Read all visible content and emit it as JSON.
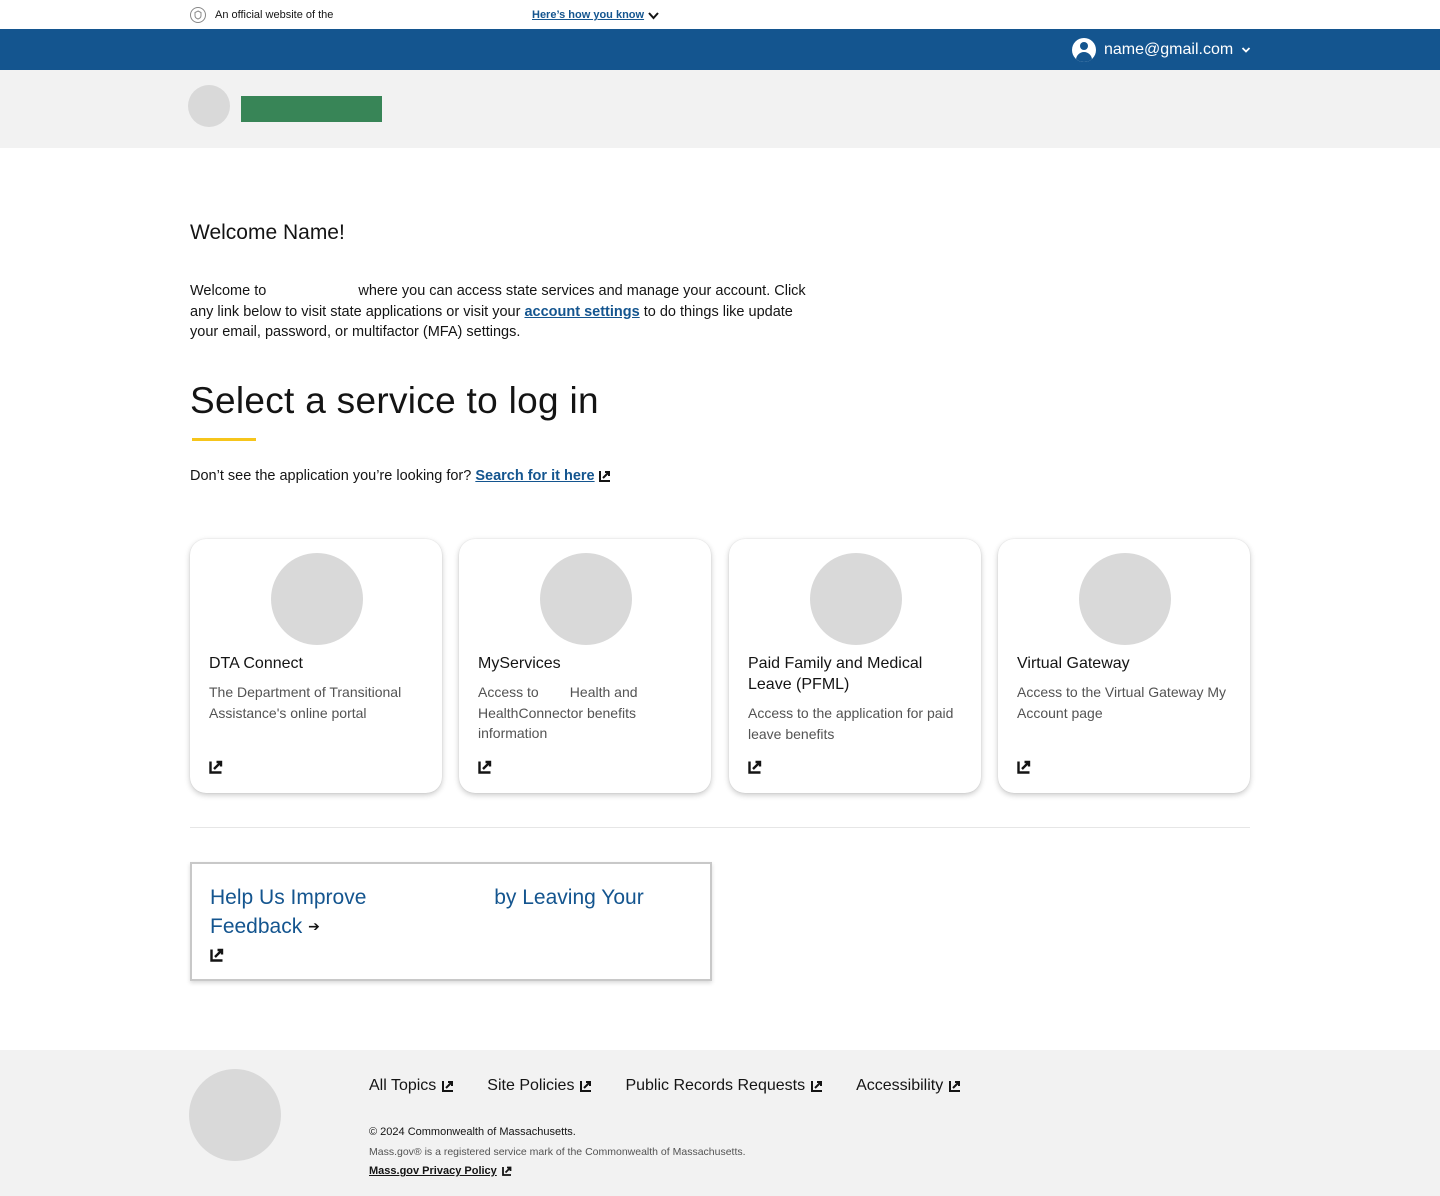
{
  "official_banner": {
    "text": "An official website of the",
    "how_you_know": "Here’s how you know"
  },
  "user_bar": {
    "email": "name@gmail.com"
  },
  "colors": {
    "brand_blue": "#14558f",
    "logo_green": "#388557",
    "accent_yellow": "#f6c51b",
    "placeholder_gray": "#d9d9d9"
  },
  "welcome": {
    "title": "Welcome Name!",
    "text_part1": "Welcome to",
    "text_part2": "where you can access state services and manage your account. Click any link below to visit state applications or visit your",
    "account_settings_link": "account settings",
    "text_part3": "to do things like update your email, password, or multifactor (MFA) settings."
  },
  "services": {
    "title": "Select a service to log in",
    "search_prompt": "Don’t see the application you’re looking for?",
    "search_link": "Search for it here",
    "cards": [
      {
        "title": "DTA Connect",
        "description": "The Department of Transitional Assistance's online portal"
      },
      {
        "title": "MyServices",
        "description": "Access to        Health and HealthConnector benefits information"
      },
      {
        "title": "Paid Family and Medical Leave (PFML)",
        "description": "Access to the application for paid leave benefits"
      },
      {
        "title": "Virtual Gateway",
        "description": "Access to the Virtual Gateway My Account page"
      }
    ]
  },
  "feedback": {
    "part1": "Help Us Improve",
    "part2": "by Leaving Your Feedback",
    "arrow": "➔"
  },
  "footer": {
    "links": [
      "All Topics",
      "Site Policies",
      "Public Records Requests",
      "Accessibility"
    ],
    "copyright": "© 2024 Commonwealth of Massachusetts.",
    "trademark": "Mass.gov® is a registered service mark of the Commonwealth of Massachusetts.",
    "privacy_link": "Mass.gov Privacy Policy"
  }
}
